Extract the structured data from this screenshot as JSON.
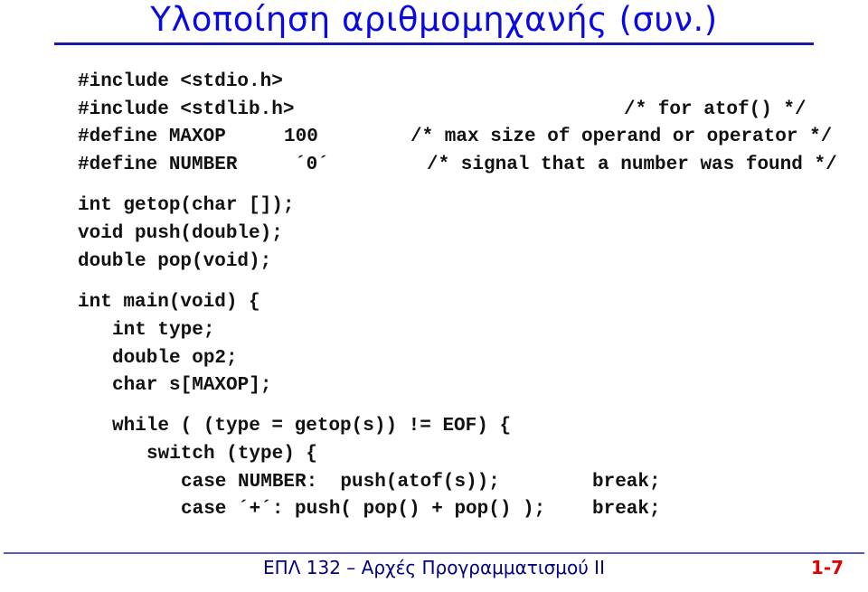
{
  "slide": {
    "title": "Υλοποίηση αριθμομηχανής (συν.)",
    "colors": {
      "title": "#0a0ae0",
      "rule": "#1a1aa8",
      "code": "#111111",
      "footer_text": "#000080",
      "page_number": "#e00000"
    }
  },
  "code": {
    "include_stdio": "#include <stdio.h>",
    "include_stdlib": "#include <stdlib.h>",
    "include_stdlib_comment": "/* for atof() */",
    "define_maxop": "#define MAXOP",
    "define_maxop_value": "100",
    "define_maxop_comment": "/* max size of operand or operator */",
    "define_number": "#define NUMBER",
    "define_number_value": "´0´",
    "define_number_comment": "/* signal that a number was found */",
    "decl_getop": "int getop(char []);",
    "decl_push": "void push(double);",
    "decl_pop": "double pop(void);",
    "main_signature": "int main(void) {",
    "var_type": "int type;",
    "var_op2": "double op2;",
    "var_s": "char s[MAXOP];",
    "while_line": "while ( (type = getop(s)) != EOF) {",
    "switch_line": "switch (type) {",
    "case_number": "case NUMBER:  push(atof(s));",
    "case_number_break": "break;",
    "case_plus": "case ´+´: push( pop() + pop() );",
    "case_plus_break": "break;"
  },
  "footer": {
    "course_title": "ΕΠΛ 132 – Αρχές Προγραμματισμού ΙΙ",
    "page_number": "1-7"
  }
}
